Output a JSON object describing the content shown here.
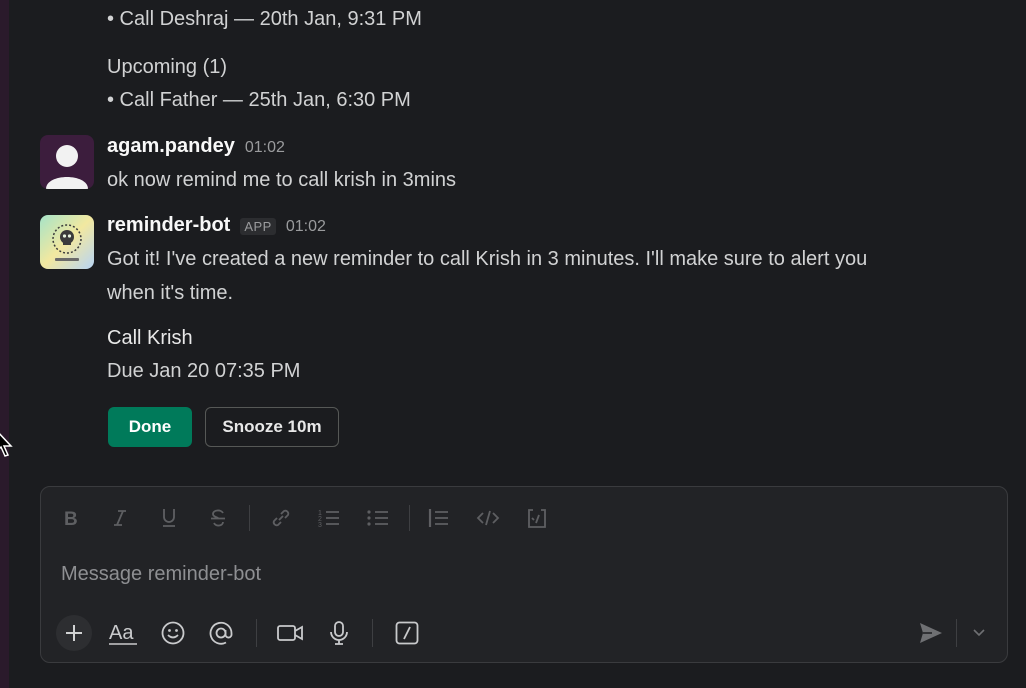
{
  "previous_message": {
    "bullet_line_1": "• Call Deshraj — 20th Jan, 9:31 PM",
    "upcoming_heading": "Upcoming (1)",
    "bullet_line_2": "• Call Father — 25th Jan, 6:30 PM"
  },
  "messages": [
    {
      "sender": "agam.pandey",
      "time": "01:02",
      "text": "ok now remind me to call krish in 3mins"
    },
    {
      "sender": "reminder-bot",
      "badge": "APP",
      "time": "01:02",
      "text_line_1": "Got it! I've created a new reminder to call Krish in 3 minutes. I'll make sure to alert you",
      "text_line_2": "when it's time.",
      "reminder_title": "Call Krish",
      "reminder_due": "Due Jan 20 07:35 PM",
      "done_label": "Done",
      "snooze_label": "Snooze 10m"
    }
  ],
  "composer": {
    "placeholder": "Message reminder-bot",
    "format_icons": [
      "bold-icon",
      "italic-icon",
      "underline-icon",
      "strikethrough-icon",
      "link-icon",
      "ordered-list-icon",
      "bulleted-list-icon",
      "blockquote-icon",
      "code-icon",
      "code-block-icon"
    ],
    "action_icons": [
      "plus-icon",
      "text-format-icon",
      "emoji-icon",
      "mention-icon",
      "video-icon",
      "microphone-icon",
      "shortcuts-icon",
      "send-icon",
      "chevron-down-icon"
    ]
  },
  "colors": {
    "background": "#1b1c1f",
    "done_button": "#007a5a",
    "text": "#d1d2d3"
  }
}
